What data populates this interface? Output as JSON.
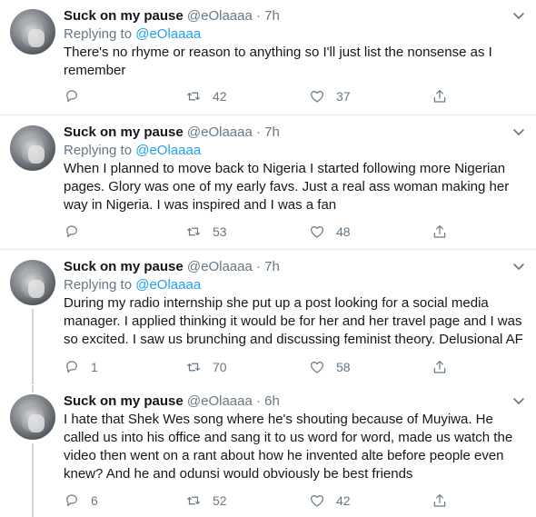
{
  "tweets": [
    {
      "name": "Suck on my pause",
      "handle": "@eOlaaaa",
      "time": "· 7h",
      "replying_prefix": "Replying to",
      "replying_to": "@eOlaaaa",
      "text": "There's no rhyme or reason to anything so I'll just list the nonsense as I remember",
      "reply_count": "",
      "retweet_count": "42",
      "like_count": "37"
    },
    {
      "name": "Suck on my pause",
      "handle": "@eOlaaaa",
      "time": "· 7h",
      "replying_prefix": "Replying to",
      "replying_to": "@eOlaaaa",
      "text": "When I planned to move back to Nigeria I started following more Nigerian pages. Glory was one of my early favs. Just a real ass woman making her way in Nigeria. I was inspired and I was a fan",
      "reply_count": "",
      "retweet_count": "53",
      "like_count": "48"
    },
    {
      "name": "Suck on my pause",
      "handle": "@eOlaaaa",
      "time": "· 7h",
      "replying_prefix": "Replying to",
      "replying_to": "@eOlaaaa",
      "text": "During my radio internship she put up a post looking for a social media manager. I applied thinking it would be for her and her travel page and I was so excited. I saw us brunching and discussing feminist theory. Delusional AF",
      "reply_count": "1",
      "retweet_count": "70",
      "like_count": "58"
    },
    {
      "name": "Suck on my pause",
      "handle": "@eOlaaaa",
      "time": "· 6h",
      "replying_prefix": "",
      "replying_to": "",
      "text": "I hate that Shek Wes song where he's shouting because of Muyiwa. He called us into his office and sang it to us word for word, made us watch the video then went on a rant about how he invented alte before people even knew? And he and odunsi would obviously be best friends",
      "reply_count": "6",
      "retweet_count": "52",
      "like_count": "42"
    }
  ],
  "icons": {
    "reply": "reply-icon",
    "retweet": "retweet-icon",
    "like": "heart-icon",
    "share": "share-icon",
    "more": "chevron-down-icon"
  },
  "colors": {
    "text": "#14171a",
    "muted": "#657786",
    "link": "#1da1f2",
    "divider": "#e6ecf0",
    "thread_line": "#ccd6dd"
  }
}
